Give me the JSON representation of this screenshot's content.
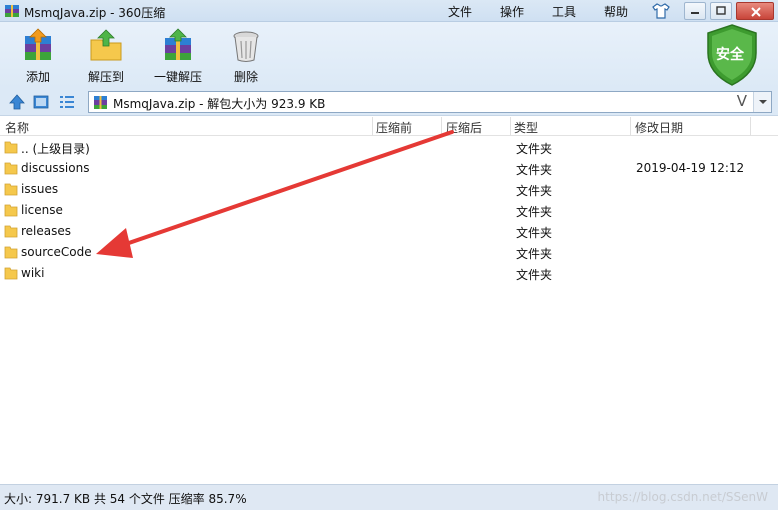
{
  "window": {
    "title": "MsmqJava.zip - 360压缩",
    "menu": [
      "文件",
      "操作",
      "工具",
      "帮助"
    ]
  },
  "toolbar": {
    "items": [
      {
        "label": "添加",
        "icon": "add-icon"
      },
      {
        "label": "解压到",
        "icon": "extract-to-icon"
      },
      {
        "label": "一键解压",
        "icon": "one-click-extract-icon"
      },
      {
        "label": "删除",
        "icon": "delete-icon"
      }
    ],
    "security_badge": "安全"
  },
  "address": {
    "text": "MsmqJava.zip - 解包大小为 923.9 KB",
    "dropdown_glyph": "V"
  },
  "columns": [
    "名称",
    "压缩前",
    "压缩后",
    "类型",
    "修改日期"
  ],
  "files": [
    {
      "name": ".. (上级目录)",
      "type": "文件夹",
      "date": ""
    },
    {
      "name": "discussions",
      "type": "文件夹",
      "date": "2019-04-19 12:12"
    },
    {
      "name": "issues",
      "type": "文件夹",
      "date": ""
    },
    {
      "name": "license",
      "type": "文件夹",
      "date": ""
    },
    {
      "name": "releases",
      "type": "文件夹",
      "date": ""
    },
    {
      "name": "sourceCode",
      "type": "文件夹",
      "date": ""
    },
    {
      "name": "wiki",
      "type": "文件夹",
      "date": ""
    }
  ],
  "status": {
    "text": "大小: 791.7 KB 共 54 个文件 压缩率 85.7%",
    "watermark": "https://blog.csdn.net/SSenW"
  },
  "colors": {
    "annotation_arrow": "#e53935",
    "folder": "#f5c84c",
    "shield": "#3d9b2f"
  }
}
